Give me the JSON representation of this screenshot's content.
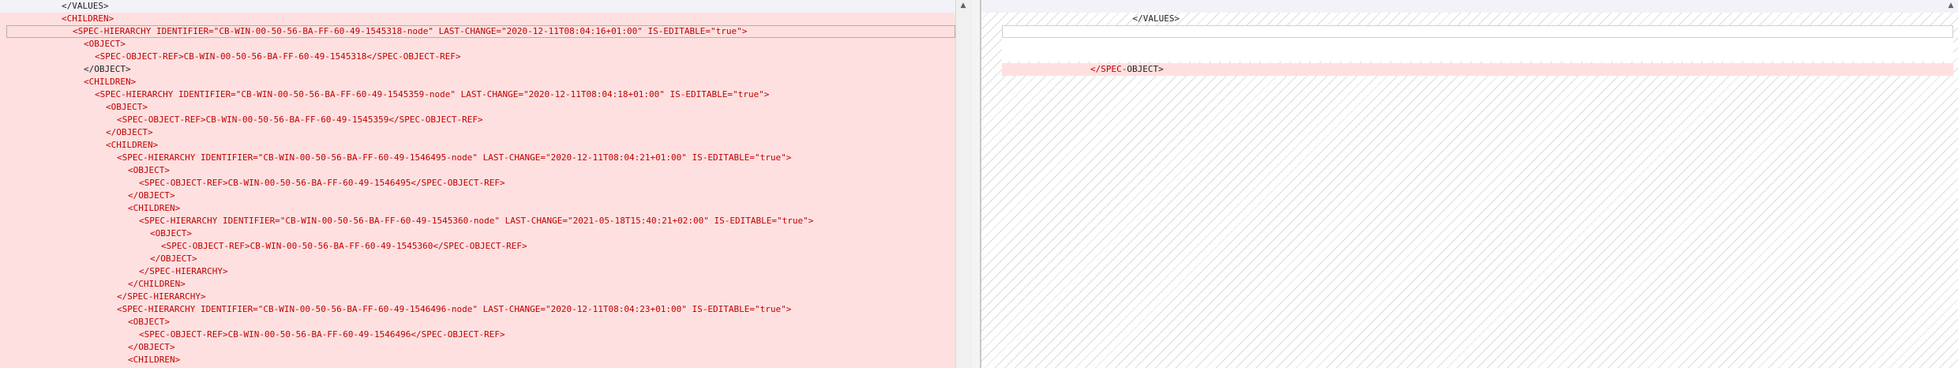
{
  "left_pane": {
    "lines": [
      {
        "indent": 0,
        "cls": "ctx",
        "text": "</VALUES>"
      },
      {
        "indent": 0,
        "cls": "tag",
        "text": "<CHILDREN>"
      },
      {
        "indent": 1,
        "cls": "tag",
        "text": "<SPEC-HIERARCHY IDENTIFIER=\"CB-WIN-00-50-56-BA-FF-60-49-1545318-node\" LAST-CHANGE=\"2020-12-11T08:04:16+01:00\" IS-EDITABLE=\"true\">"
      },
      {
        "indent": 2,
        "cls": "tag",
        "text": "<OBJECT>"
      },
      {
        "indent": 3,
        "cls": "tag",
        "text": "<SPEC-OBJECT-REF>CB-WIN-00-50-56-BA-FF-60-49-1545318</SPEC-OBJECT-REF>"
      },
      {
        "indent": 2,
        "cls": "ctx",
        "text": "</OBJECT>"
      },
      {
        "indent": 2,
        "cls": "tag",
        "text": "<CHILDREN>"
      },
      {
        "indent": 3,
        "cls": "tag",
        "text": "<SPEC-HIERARCHY IDENTIFIER=\"CB-WIN-00-50-56-BA-FF-60-49-1545359-node\" LAST-CHANGE=\"2020-12-11T08:04:18+01:00\" IS-EDITABLE=\"true\">"
      },
      {
        "indent": 4,
        "cls": "tag",
        "text": "<OBJECT>"
      },
      {
        "indent": 5,
        "cls": "tag",
        "text": "<SPEC-OBJECT-REF>CB-WIN-00-50-56-BA-FF-60-49-1545359</SPEC-OBJECT-REF>"
      },
      {
        "indent": 4,
        "cls": "tag",
        "text": "</OBJECT>"
      },
      {
        "indent": 4,
        "cls": "tag",
        "text": "<CHILDREN>"
      },
      {
        "indent": 5,
        "cls": "tag",
        "text": "<SPEC-HIERARCHY IDENTIFIER=\"CB-WIN-00-50-56-BA-FF-60-49-1546495-node\" LAST-CHANGE=\"2020-12-11T08:04:21+01:00\" IS-EDITABLE=\"true\">"
      },
      {
        "indent": 6,
        "cls": "tag",
        "text": "<OBJECT>"
      },
      {
        "indent": 7,
        "cls": "tag",
        "text": "<SPEC-OBJECT-REF>CB-WIN-00-50-56-BA-FF-60-49-1546495</SPEC-OBJECT-REF>"
      },
      {
        "indent": 6,
        "cls": "tag",
        "text": "</OBJECT>"
      },
      {
        "indent": 6,
        "cls": "tag",
        "text": "<CHILDREN>"
      },
      {
        "indent": 7,
        "cls": "tag",
        "text": "<SPEC-HIERARCHY IDENTIFIER=\"CB-WIN-00-50-56-BA-FF-60-49-1545360-node\" LAST-CHANGE=\"2021-05-18T15:40:21+02:00\" IS-EDITABLE=\"true\">"
      },
      {
        "indent": 8,
        "cls": "tag",
        "text": "<OBJECT>"
      },
      {
        "indent": 9,
        "cls": "tag",
        "text": "<SPEC-OBJECT-REF>CB-WIN-00-50-56-BA-FF-60-49-1545360</SPEC-OBJECT-REF>"
      },
      {
        "indent": 8,
        "cls": "tag",
        "text": "</OBJECT>"
      },
      {
        "indent": 7,
        "cls": "tag",
        "text": "</SPEC-HIERARCHY>"
      },
      {
        "indent": 6,
        "cls": "tag",
        "text": "</CHILDREN>"
      },
      {
        "indent": 5,
        "cls": "tag",
        "text": "</SPEC-HIERARCHY>"
      },
      {
        "indent": 5,
        "cls": "tag",
        "text": "<SPEC-HIERARCHY IDENTIFIER=\"CB-WIN-00-50-56-BA-FF-60-49-1546496-node\" LAST-CHANGE=\"2020-12-11T08:04:23+01:00\" IS-EDITABLE=\"true\">"
      },
      {
        "indent": 6,
        "cls": "tag",
        "text": "<OBJECT>"
      },
      {
        "indent": 7,
        "cls": "tag",
        "text": "<SPEC-OBJECT-REF>CB-WIN-00-50-56-BA-FF-60-49-1546496</SPEC-OBJECT-REF>"
      },
      {
        "indent": 6,
        "cls": "tag",
        "text": "</OBJECT>"
      },
      {
        "indent": 6,
        "cls": "tag",
        "text": "<CHILDREN>"
      }
    ]
  },
  "right_pane": {
    "top_line": "</VALUES>",
    "change_line_prefix": "</SPEC-",
    "change_line_suffix": "OBJECT>"
  },
  "scrollbar": {
    "up_arrow_icon": "triangle-up-icon"
  },
  "colors": {
    "deleted_bg": "#ffe0e0",
    "deleted_text": "#c00000",
    "context_text": "#222222",
    "hatch": "#dcdcdc"
  }
}
